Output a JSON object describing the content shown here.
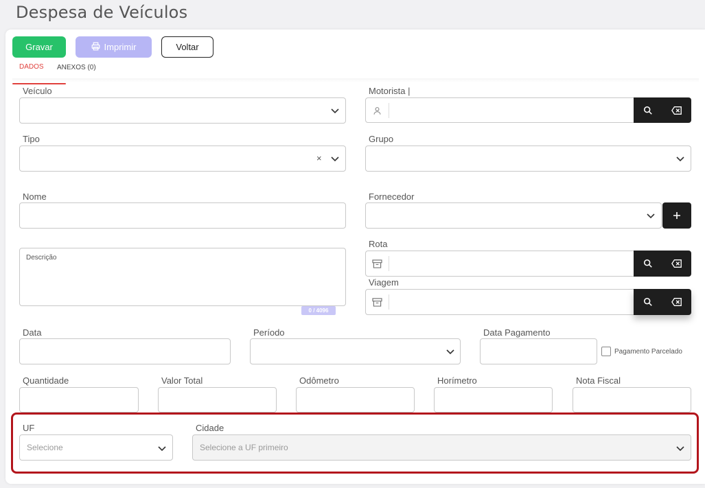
{
  "page": {
    "title": "Despesa de Veículos"
  },
  "toolbar": {
    "save_label": "Gravar",
    "print_label": "Imprimir",
    "back_label": "Voltar"
  },
  "tabs": {
    "dados": "DADOS",
    "anexos": "ANEXOS (0)"
  },
  "form": {
    "veiculo_label": "Veículo",
    "motorista_label": "Motorista |",
    "tipo_label": "Tipo",
    "grupo_label": "Grupo",
    "nome_label": "Nome",
    "fornecedor_label": "Fornecedor",
    "descricao_label": "Descrição",
    "descricao_counter": "0 / 4096",
    "rota_label": "Rota",
    "viagem_label": "Viagem",
    "data_label": "Data",
    "periodo_label": "Período",
    "data_pagamento_label": "Data Pagamento",
    "pagamento_parcelado_label": "Pagamento Parcelado",
    "quantidade_label": "Quantidade",
    "valor_total_label": "Valor Total",
    "odometro_label": "Odômetro",
    "horimetro_label": "Horímetro",
    "nota_fiscal_label": "Nota Fiscal",
    "uf_label": "UF",
    "uf_placeholder": "Selecione",
    "cidade_label": "Cidade",
    "cidade_placeholder": "Selecione a UF primeiro"
  },
  "colors": {
    "primary_green": "#27c26a",
    "disabled_purple": "#b7b6f5",
    "tab_active": "#e0403c",
    "highlight_red": "#b3151c",
    "dark_button": "#1e1e1e"
  },
  "icons": [
    "printer-icon",
    "chevron-down-icon",
    "clear-x-icon",
    "user-icon",
    "search-icon",
    "backspace-clear-icon",
    "plus-icon",
    "archive-box-icon"
  ]
}
